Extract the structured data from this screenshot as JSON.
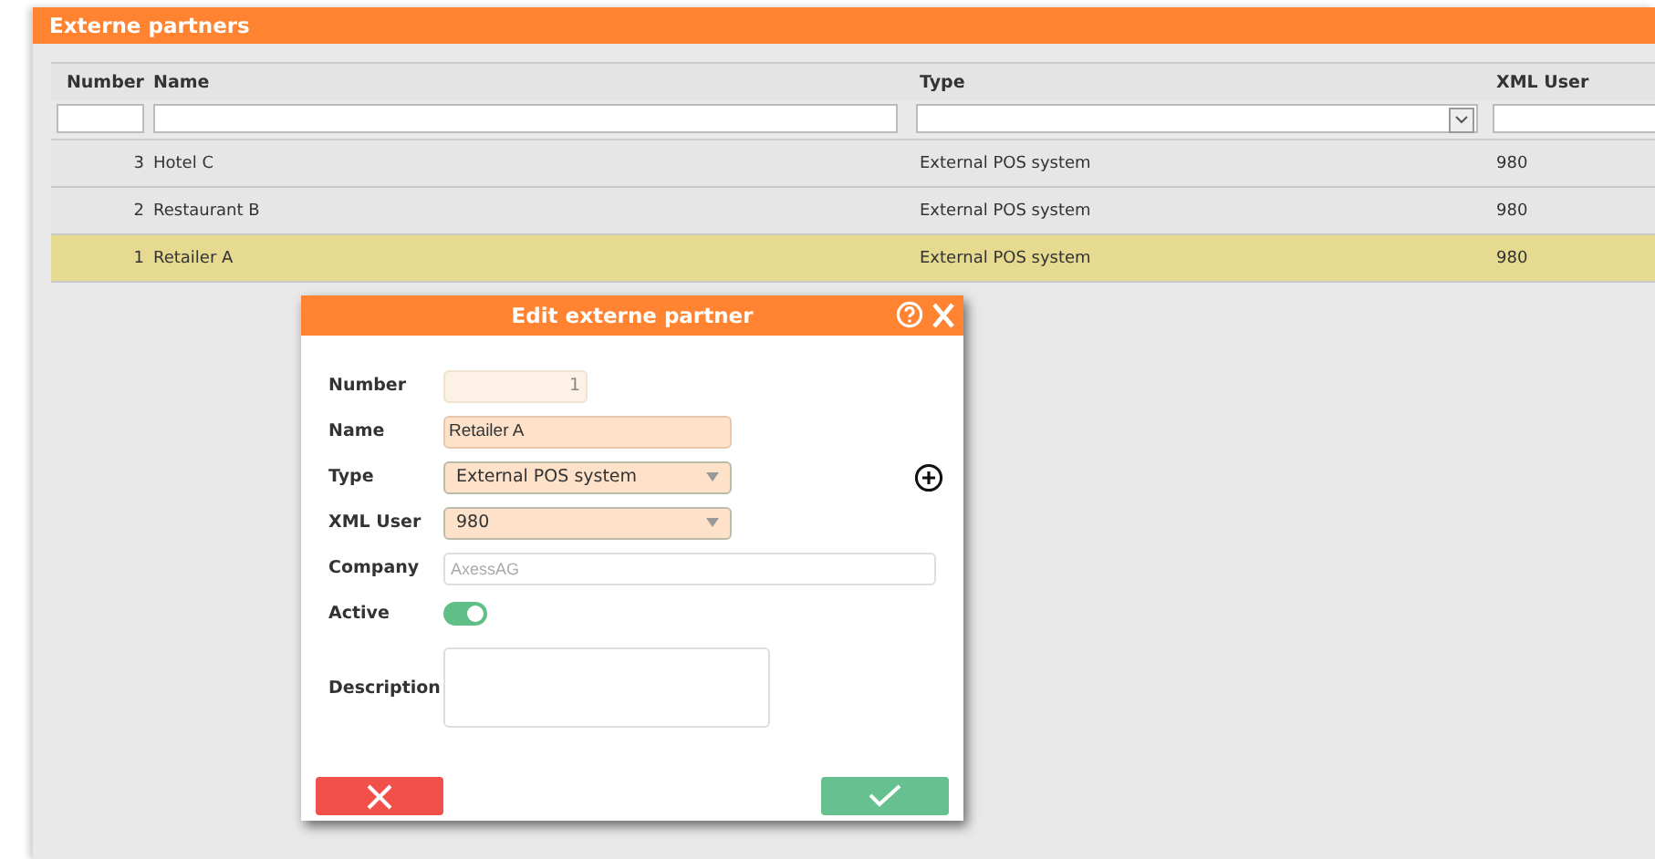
{
  "panel": {
    "title": "Externe partners"
  },
  "table": {
    "columns": [
      "Number",
      "Name",
      "Type",
      "XML User"
    ],
    "rows": [
      {
        "number": "3",
        "name": "Hotel C",
        "type": "External POS system",
        "xml_user": "980",
        "selected": false
      },
      {
        "number": "2",
        "name": "Restaurant B",
        "type": "External POS system",
        "xml_user": "980",
        "selected": false
      },
      {
        "number": "1",
        "name": "Retailer A",
        "type": "External POS system",
        "xml_user": "980",
        "selected": true
      }
    ]
  },
  "dialog": {
    "title": "Edit externe partner",
    "fields": [
      {
        "kind": "readonly",
        "label": "Number",
        "value": "1"
      },
      {
        "kind": "text",
        "label": "Name",
        "value": "Retailer A"
      },
      {
        "kind": "select",
        "label": "Type",
        "value": "External POS system",
        "add_button": true
      },
      {
        "kind": "select",
        "label": "XML User",
        "value": "980"
      },
      {
        "kind": "wide",
        "label": "Company",
        "placeholder": "AxessAG"
      },
      {
        "kind": "toggle",
        "label": "Active",
        "on": true
      },
      {
        "kind": "textarea",
        "label": "Description"
      }
    ]
  }
}
